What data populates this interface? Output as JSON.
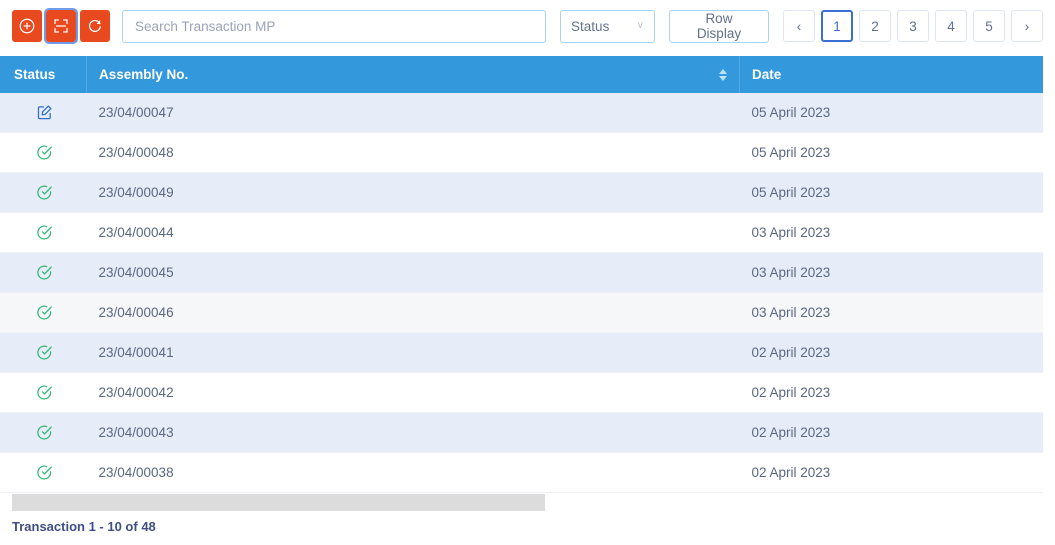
{
  "toolbar": {
    "buttons": [
      {
        "name": "add-icon",
        "label": "Add",
        "focused": false
      },
      {
        "name": "scan-icon",
        "label": "Scan",
        "focused": true
      },
      {
        "name": "refresh-icon",
        "label": "Refresh",
        "focused": false
      }
    ],
    "search": {
      "placeholder": "Search Transaction MP",
      "value": ""
    },
    "status_filter": {
      "label": "Status",
      "chevron": "∨"
    },
    "row_display": {
      "label": "Row Display"
    },
    "pagination": {
      "prev": "‹",
      "next": "›",
      "pages": [
        "1",
        "2",
        "3",
        "4",
        "5"
      ],
      "active": "1",
      "prev_disabled": true
    }
  },
  "table": {
    "columns": {
      "status": "Status",
      "assembly": "Assembly No.",
      "date": "Date"
    },
    "rows": [
      {
        "status": "edit",
        "assembly": "23/04/00047",
        "date": "05 April 2023",
        "shade": "odd"
      },
      {
        "status": "check",
        "assembly": "23/04/00048",
        "date": "05 April 2023",
        "shade": "even"
      },
      {
        "status": "check",
        "assembly": "23/04/00049",
        "date": "05 April 2023",
        "shade": "odd"
      },
      {
        "status": "check",
        "assembly": "23/04/00044",
        "date": "03 April 2023",
        "shade": "even"
      },
      {
        "status": "check",
        "assembly": "23/04/00045",
        "date": "03 April 2023",
        "shade": "odd"
      },
      {
        "status": "check",
        "assembly": "23/04/00046",
        "date": "03 April 2023",
        "shade": "hover"
      },
      {
        "status": "check",
        "assembly": "23/04/00041",
        "date": "02 April 2023",
        "shade": "odd"
      },
      {
        "status": "check",
        "assembly": "23/04/00042",
        "date": "02 April 2023",
        "shade": "even"
      },
      {
        "status": "check",
        "assembly": "23/04/00043",
        "date": "02 April 2023",
        "shade": "odd"
      },
      {
        "status": "check",
        "assembly": "23/04/00038",
        "date": "02 April 2023",
        "shade": "even"
      }
    ]
  },
  "footer": {
    "summary": "Transaction 1 - 10 of 48"
  },
  "colors": {
    "orange": "#e8491e",
    "header_blue": "#3498dd",
    "row_stripe": "#e7edf8",
    "edit_icon": "#2f6fd0",
    "check_icon": "#34b878",
    "active_page": "#3b6fd4",
    "footer_text": "#3f4f86",
    "scrollbar_thumb": "#dcdcdc"
  }
}
